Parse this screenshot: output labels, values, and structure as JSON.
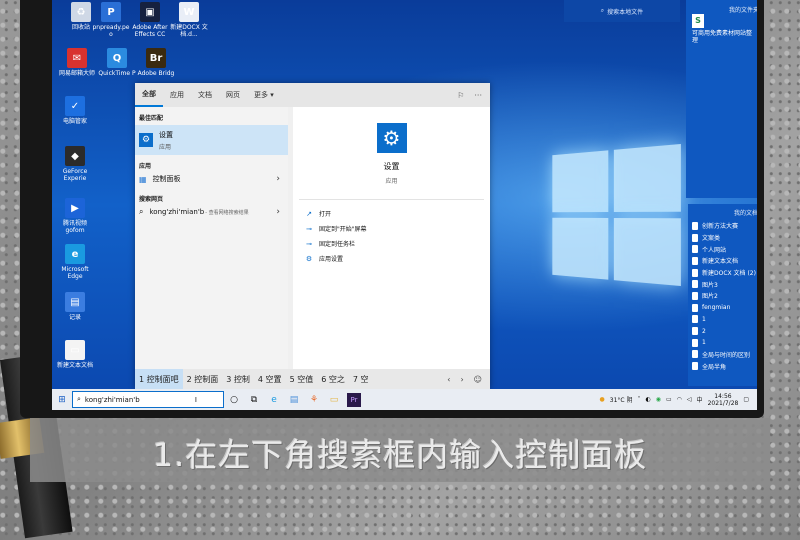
{
  "desktop_icons": [
    {
      "label": "回收站",
      "color": "#cfd8e6",
      "glyph": "♻"
    },
    {
      "label": "pnpready.pe o",
      "color": "#2a6fd6",
      "glyph": "P"
    },
    {
      "label": "Adobe After Effects CC",
      "color": "#16213f",
      "glyph": "▣"
    },
    {
      "label": "新建DOCX 文档.d...",
      "color": "#e9eef7",
      "glyph": "W"
    },
    {
      "label": "网易邮箱大师",
      "color": "#d8322f",
      "glyph": "✉"
    },
    {
      "label": "QuickTime P",
      "color": "#2b8be0",
      "glyph": "Q"
    },
    {
      "label": "Adobe Bridg",
      "color": "#3a2a10",
      "glyph": "Br"
    },
    {
      "label": "电脑管家",
      "color": "#1d6fe0",
      "glyph": "✓"
    },
    {
      "label": "GeForce Experie",
      "color": "#2b2b2b",
      "glyph": "◆"
    },
    {
      "label": "腾讯视频 gofom",
      "color": "#1c64d8",
      "glyph": "▶"
    },
    {
      "label": "Microsoft Edge",
      "color": "#1a9ae0",
      "glyph": "e"
    },
    {
      "label": "记录",
      "color": "#3b7de0",
      "glyph": "▤"
    },
    {
      "label": "新建文本文档",
      "color": "#f4f4f4",
      "glyph": "▭"
    }
  ],
  "panels": {
    "top_label": "搜索本地文件",
    "right_title": "我的文件夹",
    "right_item": "可商用免费素材网站整理",
    "docs_title": "我的文档",
    "docs": [
      "创新方法大赛",
      "文案类",
      "个人网站",
      "新建文本文档",
      "新建DOCX 文档 (2)",
      "图片3",
      "图片2",
      "fengmian",
      "1",
      "2",
      "1",
      "全局与时间的区别",
      "全局半角"
    ]
  },
  "start_menu": {
    "tabs": [
      "全部",
      "应用",
      "文档",
      "网页",
      "更多 ▾"
    ],
    "best_match_header": "最佳匹配",
    "best_match_title": "设置",
    "best_match_sub": "应用",
    "apps_header": "应用",
    "app_item": "控制面板",
    "web_header": "搜索网页",
    "web_item": "kong'zhi'mian'b",
    "web_item_sub": " - 查看网络搜索结果",
    "detail_title": "设置",
    "detail_sub": "应用",
    "actions": [
      "打开",
      "固定到\"开始\"屏幕",
      "固定到任务栏",
      "应用设置"
    ]
  },
  "ime": {
    "candidates": [
      "1 控制面吧",
      "2 控制面",
      "3 控制",
      "4 空置",
      "5 空值",
      "6 空之",
      "7 空"
    ]
  },
  "taskbar": {
    "search_text": "kong'zhi'mian'b",
    "weather": "31°C 阴",
    "time": "14:56",
    "date": "2021/7/28"
  },
  "caption": "1.在左下角搜索框内输入控制面板",
  "colors": {
    "accent": "#0b6ecb",
    "desktop": "#1261c9"
  }
}
